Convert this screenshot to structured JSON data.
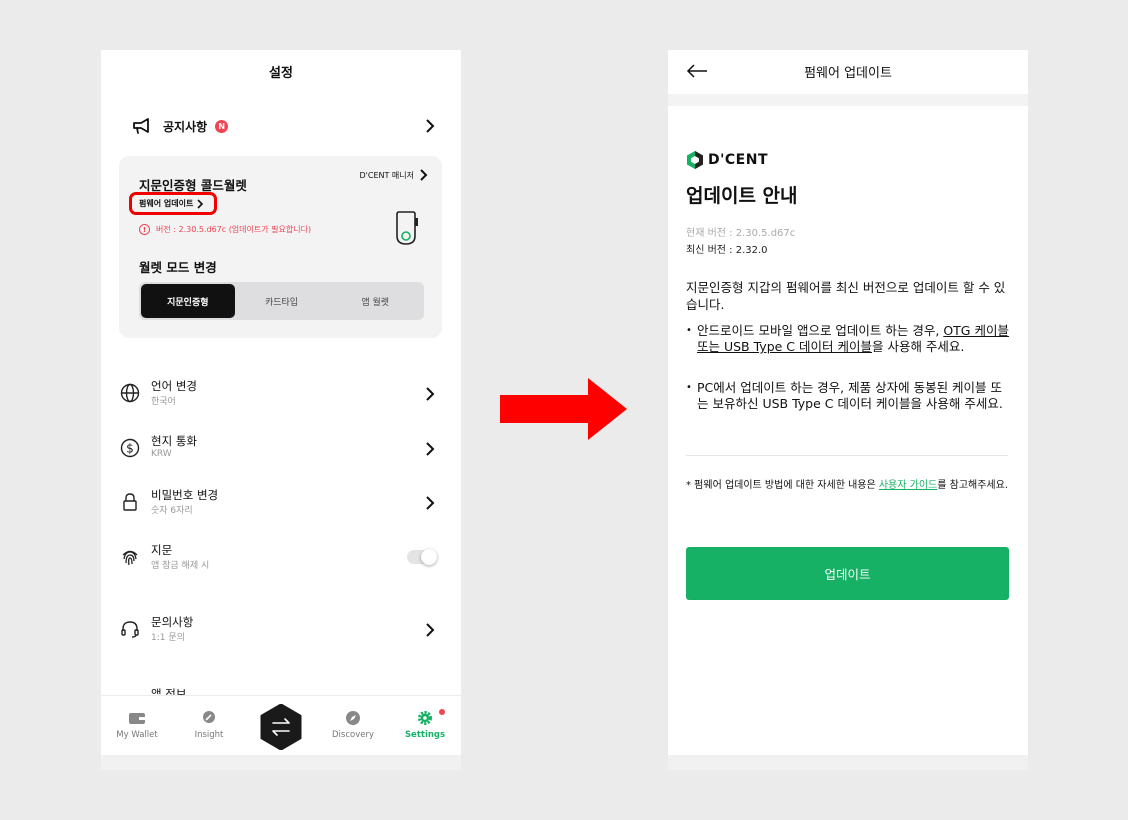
{
  "left": {
    "title": "설정",
    "notice": {
      "label": "공지사항",
      "badge": "N"
    },
    "wallet_card": {
      "title": "지문인증형 콜드월렛",
      "manager_link": "D'CENT 매니저",
      "firmware_link": "펌웨어 업데이트",
      "version_warning": "버전 : 2.30.5.d67c (업데이트가 필요합니다)",
      "mode_label": "월렛 모드 변경",
      "modes": [
        "지문인증형",
        "카드타입",
        "앱 월렛"
      ],
      "active_mode": "지문인증형"
    },
    "settings": [
      {
        "title": "언어 변경",
        "sub": "한국어",
        "icon": "globe-icon"
      },
      {
        "title": "현지 통화",
        "sub": "KRW",
        "icon": "dollar-icon"
      },
      {
        "title": "비밀번호 변경",
        "sub": "숫자 6자리",
        "icon": "lock-icon"
      },
      {
        "title": "지문",
        "sub": "앱 잠금 해제 시",
        "icon": "fingerprint-icon",
        "toggle": false
      },
      {
        "title": "문의사항",
        "sub": "1:1 문의",
        "icon": "headset-icon"
      }
    ],
    "partial_item": "앱 정보",
    "nav": [
      {
        "label": "My Wallet",
        "icon": "wallet-icon"
      },
      {
        "label": "Insight",
        "icon": "bulb-icon"
      },
      {
        "label": "Discovery",
        "icon": "compass-icon"
      },
      {
        "label": "Settings",
        "icon": "gear-icon",
        "selected": true
      }
    ]
  },
  "right": {
    "header_title": "펌웨어 업데이트",
    "logo_text": "D'CENT",
    "heading": "업데이트 안내",
    "current_version": "현재 버전 : 2.30.5.d67c",
    "latest_version": "최신 버전 : 2.32.0",
    "description": "지문인증형 지갑의 펌웨어를 최신 버전으로 업데이트 할 수 있습니다.",
    "bullet1_a": "안드로이드 모바일 앱으로 업데이트 하는 경우, ",
    "bullet1_link": "OTG 케이블 또는 USB Type C 데이터 케이블",
    "bullet1_b": "을 사용해 주세요.",
    "bullet2": "PC에서 업데이트 하는 경우, 제품 상자에 동봉된 케이블 또는 보유하신 USB Type C 데이터 케이블을 사용해 주세요.",
    "note_a": "* 펌웨어 업데이트 방법에 대한 자세한 내용은 ",
    "note_link": "사용자 가이드",
    "note_b": "를 참고해주세요.",
    "update_button": "업데이트"
  },
  "colors": {
    "accent": "#17b166",
    "alert": "#f04452",
    "highlight": "#f20000"
  }
}
